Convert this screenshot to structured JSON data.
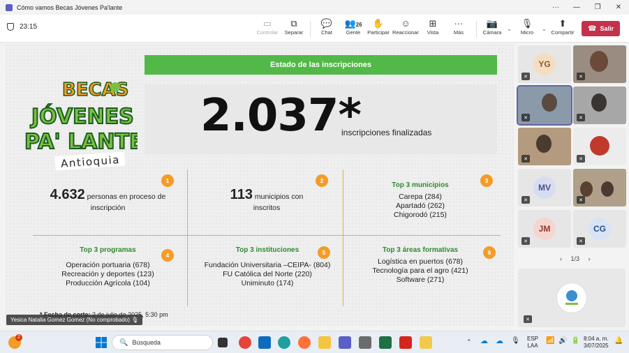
{
  "window": {
    "title": "Cómo vamos Becas Jóvenes Pa'lante",
    "more_label": "···",
    "minimize": "—",
    "maximize": "❐",
    "close": "✕"
  },
  "meeting": {
    "timer": "23:15",
    "buttons": {
      "control": "Controlar",
      "separate": "Separar",
      "chat": "Chat",
      "people": "Gente",
      "people_count": "26",
      "participate": "Participar",
      "react": "Reaccionar",
      "view": "Vista",
      "more": "Más",
      "camera": "Cámara",
      "mic": "Micro",
      "share": "Compartir",
      "leave": "Salir"
    }
  },
  "slide": {
    "logo": {
      "line1": "BECAS",
      "line2": "JÓVENES",
      "line3": "PA' LANTE",
      "region": "Antioquia"
    },
    "banner": "Estado de las inscripciones",
    "total": "2.037*",
    "total_label": "inscripciones finalizadas",
    "cells": [
      {
        "badge": "1",
        "num": "4.632",
        "text1": " personas en proceso de",
        "text2": "inscripción"
      },
      {
        "badge": "2",
        "num": "113",
        "text1": " municipios con",
        "text2": "inscritos"
      },
      {
        "badge": "3",
        "header": "Top 3 municipios",
        "items": [
          "Carepa (284)",
          "Apartadó (262)",
          "Chigorodó (215)"
        ]
      },
      {
        "badge": "4",
        "header": "Top 3 programas",
        "items": [
          "Operación portuaria (678)",
          "Recreación y deportes (123)",
          "Producción Agrícola (104)"
        ]
      },
      {
        "badge": "5",
        "header": "Top 3 instituciones",
        "items": [
          "Fundación Universitaria –CEIPA- (804)",
          "FU Católica del Norte (220)",
          "Uniminuto (174)"
        ]
      },
      {
        "badge": "6",
        "header": "Top 3 áreas formativas",
        "items": [
          "Logística en puertos (678)",
          "Tecnología para el agro (421)",
          "Software (271)"
        ]
      }
    ],
    "footnote_bold": "* Fecha de corte:",
    "footnote_rest": " 2 de julio de 2025, 5:30 pm",
    "presenter": "Yesica Natalia Gomez Gomez (No comprobado)"
  },
  "participants": {
    "tiles": [
      {
        "initials": "YG",
        "color": "#f5ddc0",
        "fg": "#8a5a2b"
      },
      {
        "initials": "",
        "video": true
      },
      {
        "initials": "",
        "video": true,
        "active": true
      },
      {
        "initials": "",
        "video": true
      },
      {
        "initials": "",
        "video": true
      },
      {
        "initials": "",
        "video": false
      },
      {
        "initials": "MV",
        "color": "#d8dcf0",
        "fg": "#4a4f8c"
      },
      {
        "initials": "",
        "video": true
      },
      {
        "initials": "JM",
        "color": "#f5d5cf",
        "fg": "#8c3b2b"
      },
      {
        "initials": "CG",
        "color": "#d8e4f5",
        "fg": "#2b4f8c"
      }
    ],
    "pager": "1/3",
    "pager_prev": "‹",
    "pager_next": "›"
  },
  "taskbar": {
    "search_placeholder": "Búsqueda",
    "notif_count": "2",
    "lang1": "ESP",
    "lang2": "LAA",
    "time": "8:04 a. m.",
    "date": "3/07/2025"
  }
}
